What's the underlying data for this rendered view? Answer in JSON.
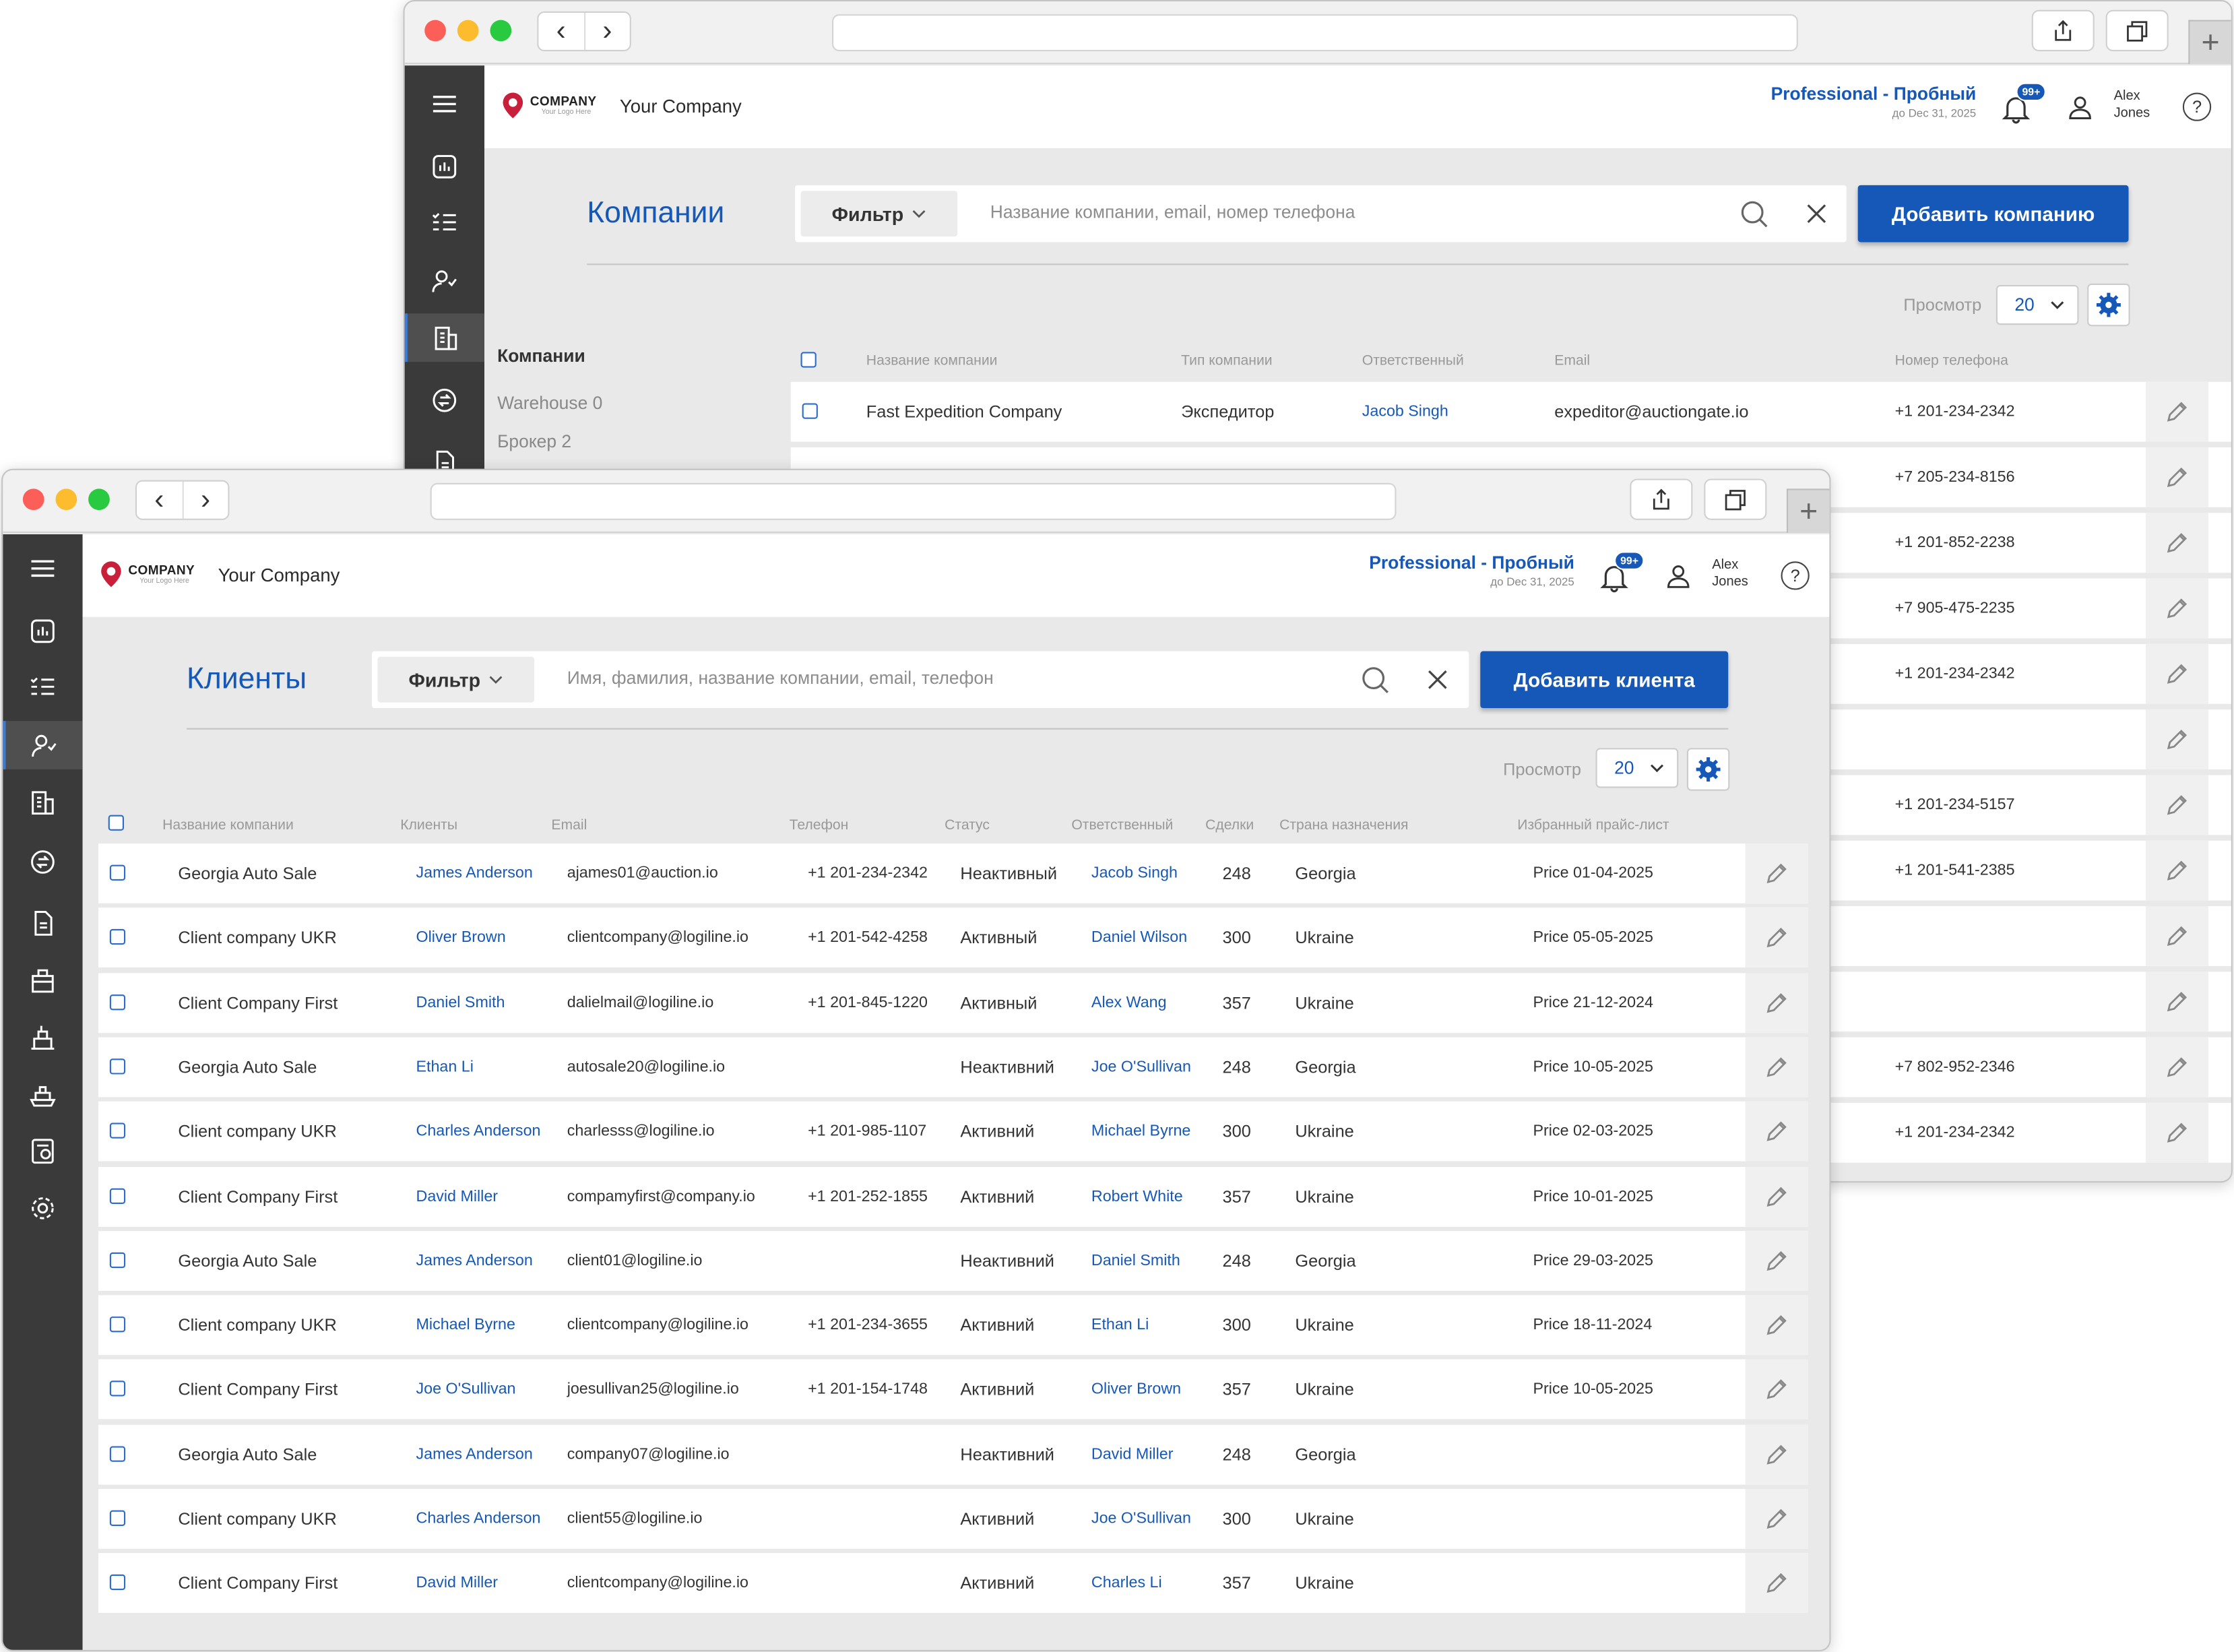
{
  "logo": {
    "brand": "COMPANY",
    "tagline": "Your Logo Here"
  },
  "company_name": "Your Company",
  "plan": {
    "label": "Professional - Пробный",
    "until": "до Dec 31, 2025"
  },
  "notifications_badge": "99+",
  "user": {
    "first": "Alex",
    "last": "Jones"
  },
  "help_symbol": "?",
  "view_label": "Просмотр",
  "view_value": "20",
  "colors": {
    "accent": "#1658b8",
    "sidebar": "#3a3a3a",
    "background": "#e9e9e9"
  },
  "back_window": {
    "title": "Компании",
    "filter_label": "Фильтр",
    "search_placeholder": "Название компании, email, номер телефона",
    "add_button": "Добавить компанию",
    "left_panel": {
      "title": "Компании",
      "items": [
        "Warehouse 0",
        "Брокер 2"
      ]
    },
    "columns": [
      "Название компании",
      "Тип компании",
      "Ответственный",
      "Email",
      "Номер телефона"
    ],
    "first_row": {
      "name": "Fast Expedition Company",
      "type": "Экспедитор",
      "manager": "Jacob Singh",
      "email": "expeditor@auctiongate.io",
      "phone": "+1 201-234-2342"
    },
    "phones": [
      "+7 205-234-8156",
      "+1 201-852-2238",
      "+7 905-475-2235",
      "+1 201-234-2342",
      "",
      "+1 201-234-5157",
      "+1 201-541-2385",
      "",
      "",
      "+7 802-952-2346",
      "+1 201-234-2342"
    ]
  },
  "front_window": {
    "title": "Клиенты",
    "filter_label": "Фильтр",
    "search_placeholder": "Имя, фамилия, название компании, email, телефон",
    "add_button": "Добавить клиента",
    "columns": [
      "Название компании",
      "Клиенты",
      "Email",
      "Телефон",
      "Статус",
      "Ответственный",
      "Сделки",
      "Страна назначения",
      "Избранный прайс-лист"
    ],
    "rows": [
      {
        "company": "Georgia Auto Sale",
        "client": "James Anderson",
        "email": "ajames01@auction.io",
        "phone": "+1 201-234-2342",
        "status": "Неактивный",
        "manager": "Jacob Singh",
        "deals": "248",
        "country": "Georgia",
        "price": "Price 01-04-2025"
      },
      {
        "company": "Client company UKR",
        "client": "Oliver Brown",
        "email": "clientcompany@logiline.io",
        "phone": "+1 201-542-4258",
        "status": "Активный",
        "manager": "Daniel Wilson",
        "deals": "300",
        "country": "Ukraine",
        "price": "Price 05-05-2025"
      },
      {
        "company": "Client Company First",
        "client": "Daniel Smith",
        "email": "dalielmail@logiline.io",
        "phone": "+1 201-845-1220",
        "status": "Активный",
        "manager": "Alex Wang",
        "deals": "357",
        "country": "Ukraine",
        "price": "Price 21-12-2024"
      },
      {
        "company": "Georgia Auto Sale",
        "client": "Ethan Li",
        "email": "autosale20@logiline.io",
        "phone": "",
        "status": "Неактивний",
        "manager": "Joe O'Sullivan",
        "deals": "248",
        "country": "Georgia",
        "price": "Price 10-05-2025"
      },
      {
        "company": "Client company UKR",
        "client": "Charles Anderson",
        "email": "charlesss@logiline.io",
        "phone": "+1 201-985-1107",
        "status": "Активний",
        "manager": "Michael Byrne",
        "deals": "300",
        "country": "Ukraine",
        "price": "Price 02-03-2025"
      },
      {
        "company": "Client Company First",
        "client": "David Miller",
        "email": "compamyfirst@company.io",
        "phone": "+1 201-252-1855",
        "status": "Активний",
        "manager": "Robert White",
        "deals": "357",
        "country": "Ukraine",
        "price": "Price 10-01-2025"
      },
      {
        "company": "Georgia Auto Sale",
        "client": "James Anderson",
        "email": "client01@logiline.io",
        "phone": "",
        "status": "Неактивний",
        "manager": "Daniel Smith",
        "deals": "248",
        "country": "Georgia",
        "price": "Price 29-03-2025"
      },
      {
        "company": "Client company UKR",
        "client": "Michael Byrne",
        "email": "clientcompany@logiline.io",
        "phone": "+1 201-234-3655",
        "status": "Активний",
        "manager": "Ethan Li",
        "deals": "300",
        "country": "Ukraine",
        "price": "Price 18-11-2024"
      },
      {
        "company": "Client Company First",
        "client": "Joe O'Sullivan",
        "email": "joesullivan25@logiline.io",
        "phone": "+1 201-154-1748",
        "status": "Активний",
        "manager": "Oliver Brown",
        "deals": "357",
        "country": "Ukraine",
        "price": "Price 10-05-2025"
      },
      {
        "company": "Georgia Auto Sale",
        "client": "James Anderson",
        "email": "company07@logiline.io",
        "phone": "",
        "status": "Неактивний",
        "manager": "David Miller",
        "deals": "248",
        "country": "Georgia",
        "price": ""
      },
      {
        "company": "Client company UKR",
        "client": "Charles Anderson",
        "email": "client55@logiline.io",
        "phone": "",
        "status": "Активний",
        "manager": "Joe O'Sullivan",
        "deals": "300",
        "country": "Ukraine",
        "price": ""
      },
      {
        "company": "Client Company First",
        "client": "David Miller",
        "email": "clientcompany@logiline.io",
        "phone": "",
        "status": "Активний",
        "manager": "Charles Li",
        "deals": "357",
        "country": "Ukraine",
        "price": ""
      }
    ]
  }
}
